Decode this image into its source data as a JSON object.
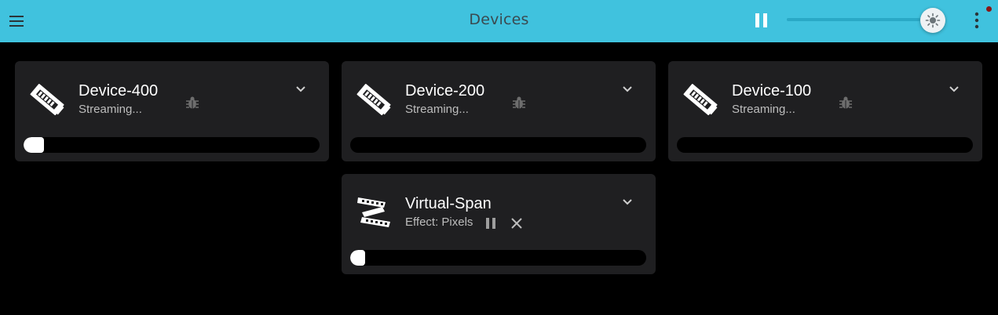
{
  "appbar": {
    "title": "Devices",
    "brightness_level": 0.91
  },
  "devices": [
    {
      "name": "Device-400",
      "status": "Streaming...",
      "icon": "led-strip-icon",
      "progress": 0.07
    },
    {
      "name": "Device-200",
      "status": "Streaming...",
      "icon": "led-strip-icon",
      "progress": 0.0
    },
    {
      "name": "Device-100",
      "status": "Streaming...",
      "icon": "led-strip-icon",
      "progress": 0.0
    }
  ],
  "virtual": {
    "name": "Virtual-Span",
    "status": "Effect: Pixels",
    "icon": "film-strip-icon",
    "progress": 0.05
  },
  "colors": {
    "appbar": "#40c2de",
    "card": "#1f1f21",
    "background": "#000000"
  }
}
